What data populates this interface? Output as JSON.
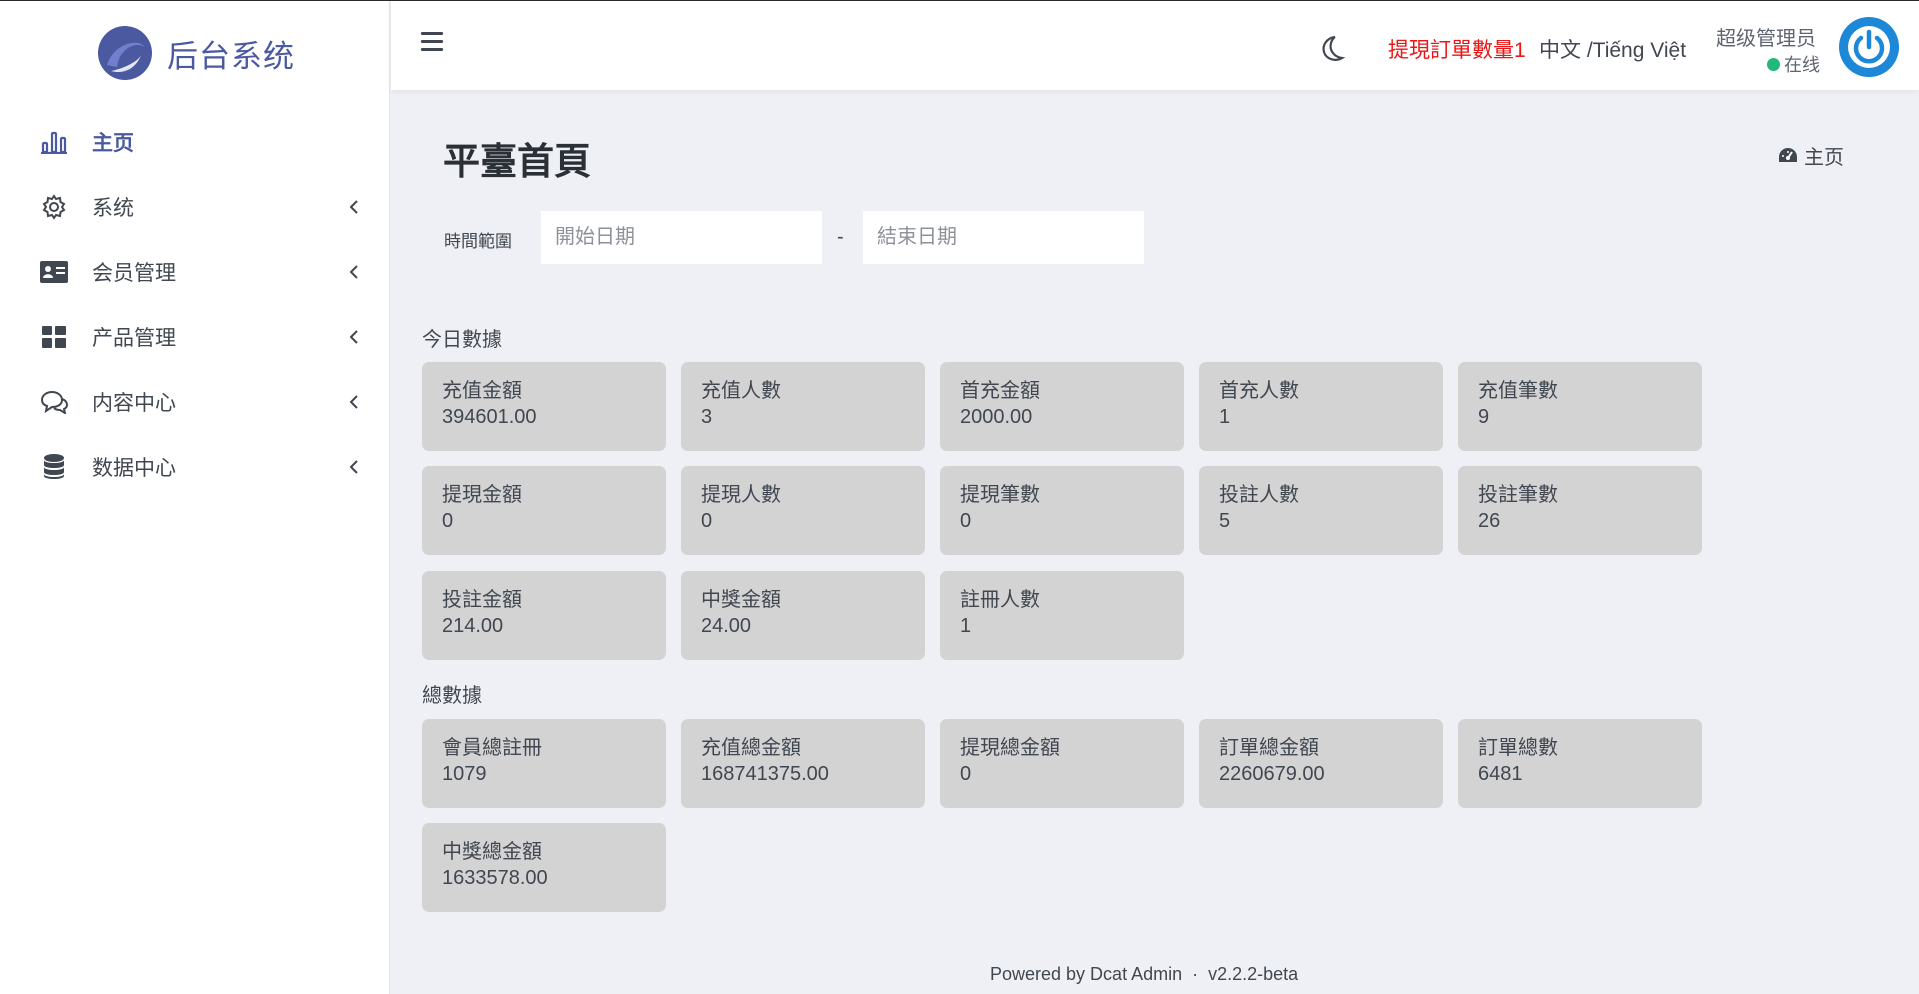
{
  "brand": {
    "name": "后台系统"
  },
  "sidebar": {
    "items": [
      {
        "label": "主页",
        "icon": "bar-chart-icon",
        "active": true
      },
      {
        "label": "系统",
        "icon": "gear-icon"
      },
      {
        "label": "会员管理",
        "icon": "id-card-icon"
      },
      {
        "label": "产品管理",
        "icon": "grid-icon"
      },
      {
        "label": "内容中心",
        "icon": "chat-bubbles-icon"
      },
      {
        "label": "数据中心",
        "icon": "database-icon"
      }
    ]
  },
  "header": {
    "alert": "提現訂單數量1",
    "language": "中文 /Tiếng Việt",
    "user_name": "超级管理员",
    "user_status": "在线"
  },
  "page": {
    "title": "平臺首頁",
    "breadcrumb": "主页"
  },
  "filter": {
    "label": "時間範圍",
    "start_placeholder": "開始日期",
    "separator": "-",
    "end_placeholder": "結束日期"
  },
  "today": {
    "title": "今日數據",
    "cards": [
      {
        "label": "充值金額",
        "value": "394601.00"
      },
      {
        "label": "充值人數",
        "value": "3"
      },
      {
        "label": "首充金額",
        "value": "2000.00"
      },
      {
        "label": "首充人數",
        "value": "1"
      },
      {
        "label": "充值筆數",
        "value": "9"
      },
      {
        "label": "提現金額",
        "value": "0"
      },
      {
        "label": "提現人數",
        "value": "0"
      },
      {
        "label": "提現筆數",
        "value": "0"
      },
      {
        "label": "投註人數",
        "value": "5"
      },
      {
        "label": "投註筆數",
        "value": "26"
      },
      {
        "label": "投註金額",
        "value": "214.00"
      },
      {
        "label": "中獎金額",
        "value": "24.00"
      },
      {
        "label": "註冊人數",
        "value": "1"
      }
    ]
  },
  "total": {
    "title": "總數據",
    "cards": [
      {
        "label": "會員總註冊",
        "value": "1079"
      },
      {
        "label": "充值總金額",
        "value": "168741375.00"
      },
      {
        "label": "提現總金額",
        "value": "0"
      },
      {
        "label": "訂單總金額",
        "value": "2260679.00"
      },
      {
        "label": "訂單總數",
        "value": "6481"
      },
      {
        "label": "中獎總金額",
        "value": "1633578.00"
      }
    ]
  },
  "footer": {
    "powered": "Powered by Dcat Admin",
    "dot": "·",
    "version": "v2.2.2-beta"
  },
  "colors": {
    "brand": "#4b5aa0",
    "alert": "#ea1616",
    "online": "#21b978",
    "avatar": "#1e88d8",
    "card": "#d3d3d3",
    "background": "#eff0f5"
  }
}
